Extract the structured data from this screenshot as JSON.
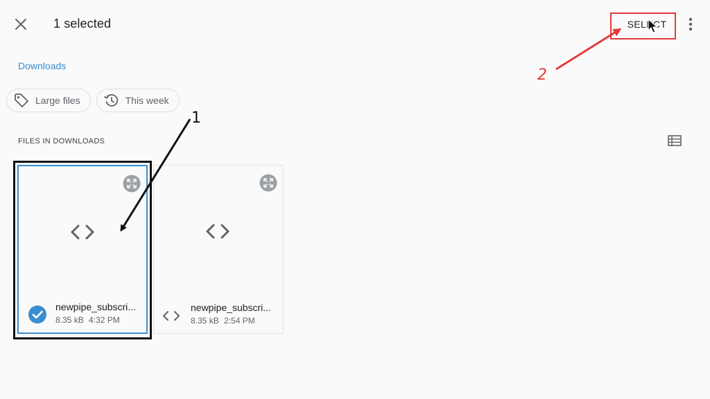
{
  "header": {
    "title": "1 selected",
    "close_icon": "close-icon",
    "select_label": "SELECT",
    "more_icon": "more-vert-icon"
  },
  "breadcrumb": {
    "label": "Downloads"
  },
  "chips": [
    {
      "label": "Large files",
      "icon": "tag-icon"
    },
    {
      "label": "This week",
      "icon": "history-icon"
    }
  ],
  "section": {
    "title": "FILES IN DOWNLOADS",
    "view_toggle_icon": "list-view-icon"
  },
  "files": [
    {
      "name": "newpipe_subscri...",
      "size": "8.35 kB",
      "time": "4:32 PM",
      "selected": true
    },
    {
      "name": "newpipe_subscri...",
      "size": "8.35 kB",
      "time": "2:54 PM",
      "selected": false
    }
  ],
  "annotations": {
    "step1": "1",
    "step2": "2"
  },
  "colors": {
    "accent": "#3a8ed0",
    "annotation_red": "#e23b3b",
    "annotation_black": "#111111",
    "background": "#fafafa"
  }
}
